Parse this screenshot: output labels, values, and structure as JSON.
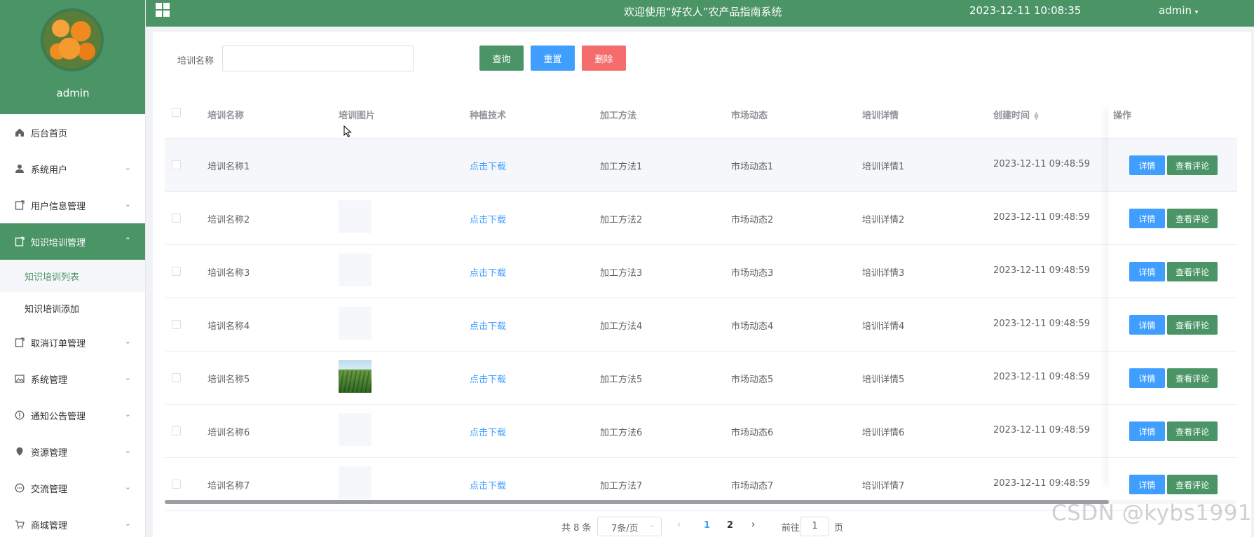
{
  "sidebar": {
    "username": "admin",
    "menu": [
      {
        "label": "后台首页",
        "icon": "home-icon"
      },
      {
        "label": "系统用户",
        "icon": "user-icon"
      },
      {
        "label": "用户信息管理",
        "icon": "document-icon"
      },
      {
        "label": "知识培训管理",
        "icon": "document-icon"
      },
      {
        "label": "取消订单管理",
        "icon": "document-icon"
      },
      {
        "label": "系统管理",
        "icon": "image-icon"
      },
      {
        "label": "通知公告管理",
        "icon": "info-icon"
      },
      {
        "label": "资源管理",
        "icon": "location-icon"
      },
      {
        "label": "交流管理",
        "icon": "chat-icon"
      },
      {
        "label": "商城管理",
        "icon": "cart-icon"
      }
    ],
    "submenu": [
      "知识培训列表",
      "知识培训添加"
    ]
  },
  "topbar": {
    "title": "欢迎使用“好农人”农产品指南系统",
    "datetime": "2023-12-11 10:08:35",
    "user": "admin"
  },
  "search": {
    "label": "培训名称",
    "value": "",
    "query_btn": "查询",
    "reset_btn": "重置",
    "delete_btn": "删除"
  },
  "table": {
    "headers": {
      "name": "培训名称",
      "image": "培训图片",
      "tech": "种植技术",
      "process": "加工方法",
      "market": "市场动态",
      "detail": "培训详情",
      "created": "创建时间",
      "ops": "操作"
    },
    "rows": [
      {
        "name": "培训名称1",
        "tech": "点击下载",
        "process": "加工方法1",
        "market": "市场动态1",
        "detail": "培训详情1",
        "created": "2023-12-11 09:48:59",
        "image": "none"
      },
      {
        "name": "培训名称2",
        "tech": "点击下载",
        "process": "加工方法2",
        "market": "市场动态2",
        "detail": "培训详情2",
        "created": "2023-12-11 09:48:59",
        "image": "blank"
      },
      {
        "name": "培训名称3",
        "tech": "点击下载",
        "process": "加工方法3",
        "market": "市场动态3",
        "detail": "培训详情3",
        "created": "2023-12-11 09:48:59",
        "image": "blank"
      },
      {
        "name": "培训名称4",
        "tech": "点击下载",
        "process": "加工方法4",
        "market": "市场动态4",
        "detail": "培训详情4",
        "created": "2023-12-11 09:48:59",
        "image": "blank"
      },
      {
        "name": "培训名称5",
        "tech": "点击下载",
        "process": "加工方法5",
        "market": "市场动态5",
        "detail": "培训详情5",
        "created": "2023-12-11 09:48:59",
        "image": "field"
      },
      {
        "name": "培训名称6",
        "tech": "点击下载",
        "process": "加工方法6",
        "market": "市场动态6",
        "detail": "培训详情6",
        "created": "2023-12-11 09:48:59",
        "image": "blank"
      },
      {
        "name": "培训名称7",
        "tech": "点击下载",
        "process": "加工方法7",
        "market": "市场动态7",
        "detail": "培训详情7",
        "created": "2023-12-11 09:48:59",
        "image": "blank"
      }
    ],
    "op_detail": "详情",
    "op_comment": "查看评论"
  },
  "pagination": {
    "total": "共 8 条",
    "page_size": "7条/页",
    "pages": [
      "1",
      "2"
    ],
    "goto_label": "前往",
    "goto_value": "1",
    "page_suffix": "页"
  },
  "watermark": "CSDN @kybs1991",
  "colors": {
    "primary_green": "#4a9466",
    "primary_blue": "#409eff",
    "danger": "#f56c6c"
  }
}
